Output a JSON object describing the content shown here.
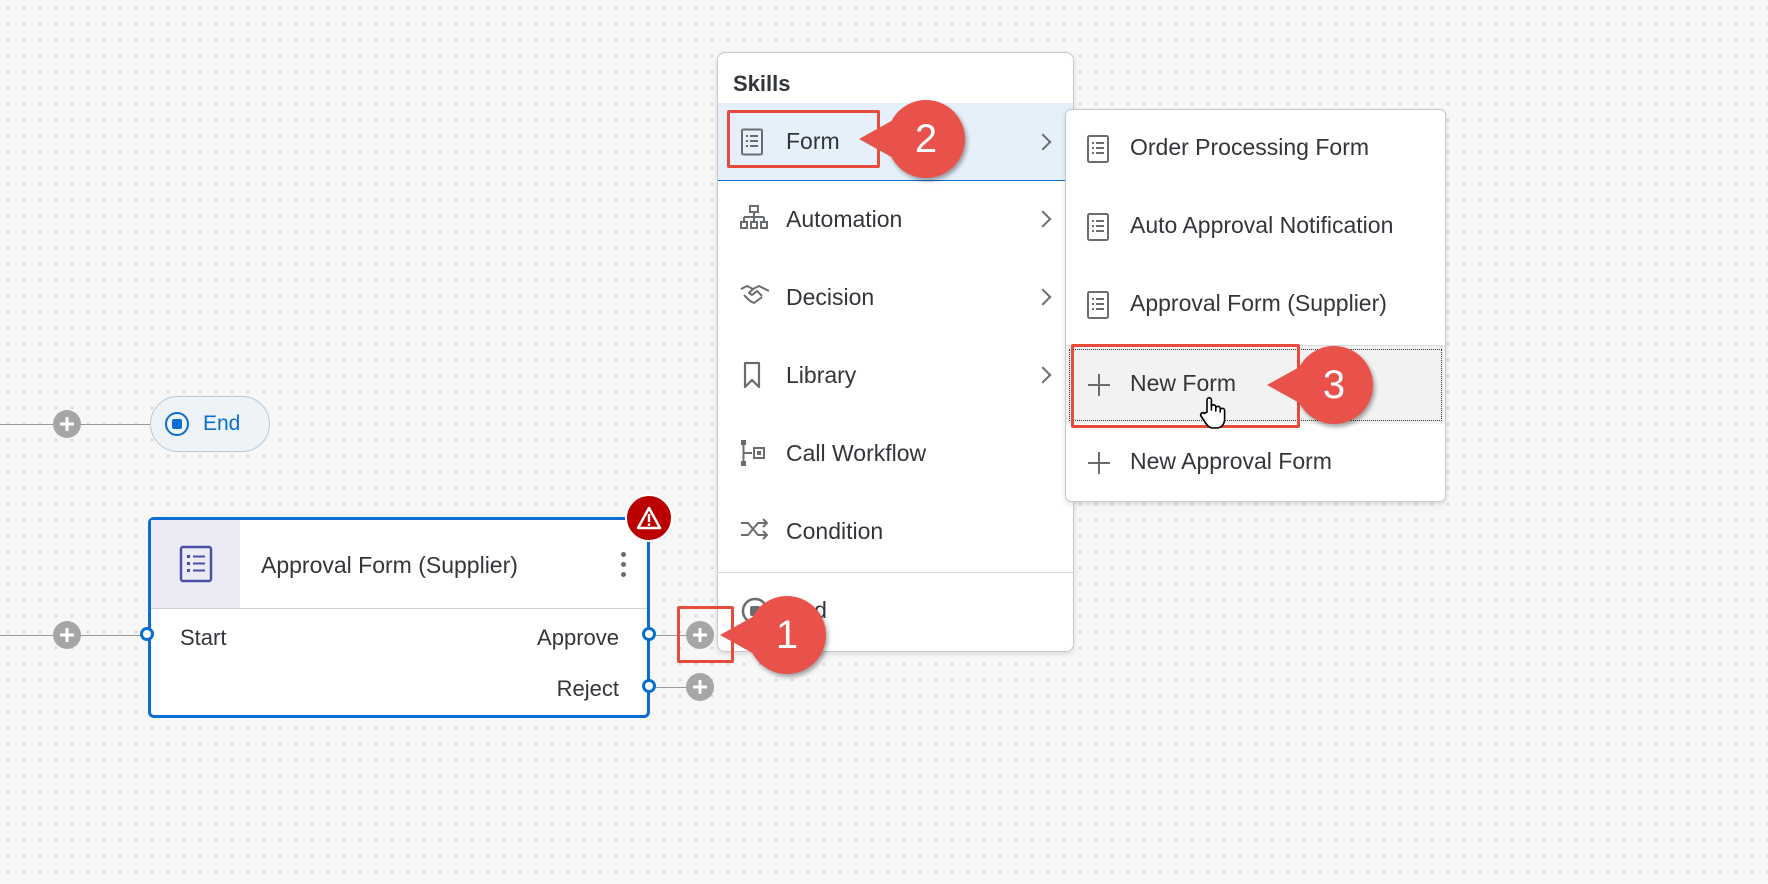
{
  "canvas": {
    "end_node": {
      "label": "End"
    },
    "form_node": {
      "title": "Approval Form (Supplier)",
      "input_label": "Start",
      "outputs": [
        "Approve",
        "Reject"
      ]
    }
  },
  "skills_menu": {
    "header": "Skills",
    "items": [
      {
        "label": "Form",
        "icon": "form-icon",
        "has_submenu": true,
        "selected": true
      },
      {
        "label": "Automation",
        "icon": "automation-icon",
        "has_submenu": true
      },
      {
        "label": "Decision",
        "icon": "decision-icon",
        "has_submenu": true
      },
      {
        "label": "Library",
        "icon": "bookmark-icon",
        "has_submenu": true
      },
      {
        "label": "Call Workflow",
        "icon": "call-workflow-icon",
        "has_submenu": false
      },
      {
        "label": "Condition",
        "icon": "condition-icon",
        "has_submenu": false
      },
      {
        "label": "End",
        "icon": "end-icon",
        "has_submenu": false
      }
    ]
  },
  "form_submenu": {
    "items": [
      {
        "label": "Order Processing Form",
        "icon": "form-icon"
      },
      {
        "label": "Auto Approval Notification",
        "icon": "form-icon"
      },
      {
        "label": "Approval Form (Supplier)",
        "icon": "form-icon"
      },
      {
        "label": "New Form",
        "icon": "plus-icon",
        "focused": true
      },
      {
        "label": "New Approval Form",
        "icon": "plus-icon"
      }
    ]
  },
  "callouts": [
    "1",
    "2",
    "3"
  ],
  "colors": {
    "accent": "#0a6ed1",
    "callout": "#e8524a",
    "error": "#bb0000"
  }
}
